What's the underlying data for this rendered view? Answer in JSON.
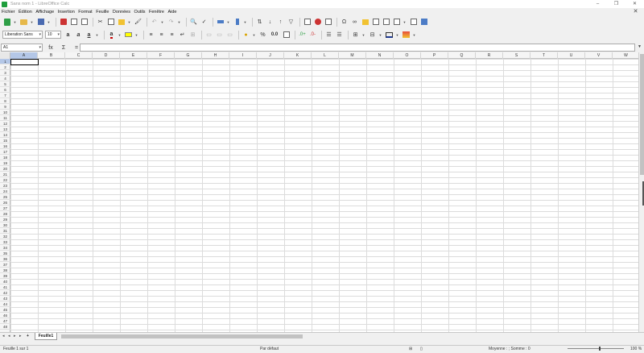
{
  "window": {
    "title": "Sans nom 1 - LibreOffice Calc",
    "min": "–",
    "max": "❐",
    "close": "✕"
  },
  "menu": [
    "Fichier",
    "Édition",
    "Affichage",
    "Insertion",
    "Format",
    "Feuille",
    "Données",
    "Outils",
    "Fenêtre",
    "Aide"
  ],
  "menu_close": "✕",
  "font": {
    "name": "Liberation Sans",
    "size": "10"
  },
  "formula": {
    "cell_ref": "A1",
    "fx": "fx",
    "sigma": "Σ",
    "equals": "="
  },
  "columns": [
    "A",
    "B",
    "C",
    "D",
    "E",
    "F",
    "G",
    "H",
    "I",
    "J",
    "K",
    "L",
    "M",
    "N",
    "O",
    "P",
    "Q",
    "R",
    "S",
    "T",
    "U",
    "V",
    "W"
  ],
  "rows": [
    "1",
    "2",
    "3",
    "4",
    "5",
    "6",
    "7",
    "8",
    "9",
    "10",
    "11",
    "12",
    "13",
    "14",
    "15",
    "16",
    "17",
    "18",
    "19",
    "20",
    "21",
    "22",
    "23",
    "24",
    "25",
    "26",
    "27",
    "28",
    "29",
    "30",
    "31",
    "32",
    "33",
    "34",
    "35",
    "36",
    "37",
    "38",
    "39",
    "40",
    "41",
    "42",
    "43",
    "44",
    "45",
    "46",
    "47",
    "48"
  ],
  "sheet_tab": "Feuille1",
  "status": {
    "sheet": "Feuille 1 sur 1",
    "style": "Par défaut",
    "summary": "Moyenne : ; Somme : 0",
    "zoom": "100 %"
  },
  "toolbar2_text": {
    "percent": "%",
    "decimal": "0.0"
  }
}
